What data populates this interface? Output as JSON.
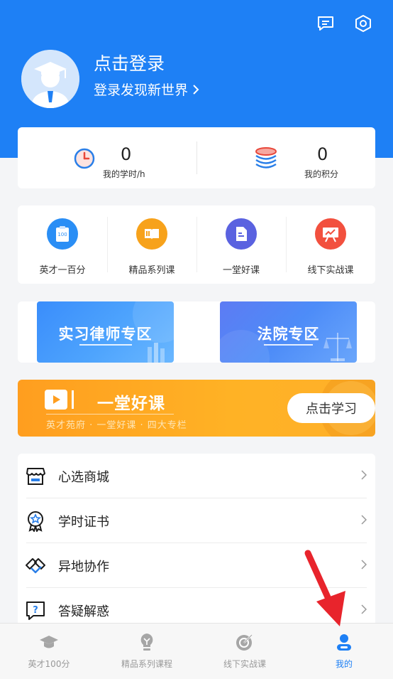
{
  "profile": {
    "login_title": "点击登录",
    "login_subtitle": "登录发现新世界",
    "chevron": "›"
  },
  "header_icons": [
    "message-icon",
    "settings-icon"
  ],
  "stats": [
    {
      "value": "0",
      "label": "我的学时/h",
      "icon": "clock-icon"
    },
    {
      "value": "0",
      "label": "我的积分",
      "icon": "coins-icon"
    }
  ],
  "features": [
    {
      "label": "英才一百分",
      "icon": "clipboard-100-icon",
      "color": "#2a8ef5"
    },
    {
      "label": "精品系列课",
      "icon": "book-icon",
      "color": "#f7a21b"
    },
    {
      "label": "一堂好课",
      "icon": "document-icon",
      "color": "#5a62e0"
    },
    {
      "label": "线下实战课",
      "icon": "presentation-icon",
      "color": "#f2503e"
    }
  ],
  "banners": [
    {
      "title": "实习律师专区"
    },
    {
      "title": "法院专区"
    }
  ],
  "promo": {
    "title": "一堂好课",
    "subtitle": "英才苑府 · 一堂好课 · 四大专栏",
    "button": "点击学习"
  },
  "menu": [
    {
      "label": "心选商城",
      "icon": "store-icon"
    },
    {
      "label": "学时证书",
      "icon": "certificate-icon"
    },
    {
      "label": "异地协作",
      "icon": "handshake-icon"
    },
    {
      "label": "答疑解惑",
      "icon": "question-icon"
    }
  ],
  "tabs": [
    {
      "label": "英才100分",
      "icon": "graduation-cap-icon",
      "active": false
    },
    {
      "label": "精品系列课程",
      "icon": "lightbulb-icon",
      "active": false
    },
    {
      "label": "线下实战课",
      "icon": "target-icon",
      "active": false
    },
    {
      "label": "我的",
      "icon": "user-icon",
      "active": true
    }
  ],
  "colors": {
    "primary": "#1e80f5",
    "promo_orange": "#ffa41f",
    "annotation_arrow": "#e8242c"
  }
}
